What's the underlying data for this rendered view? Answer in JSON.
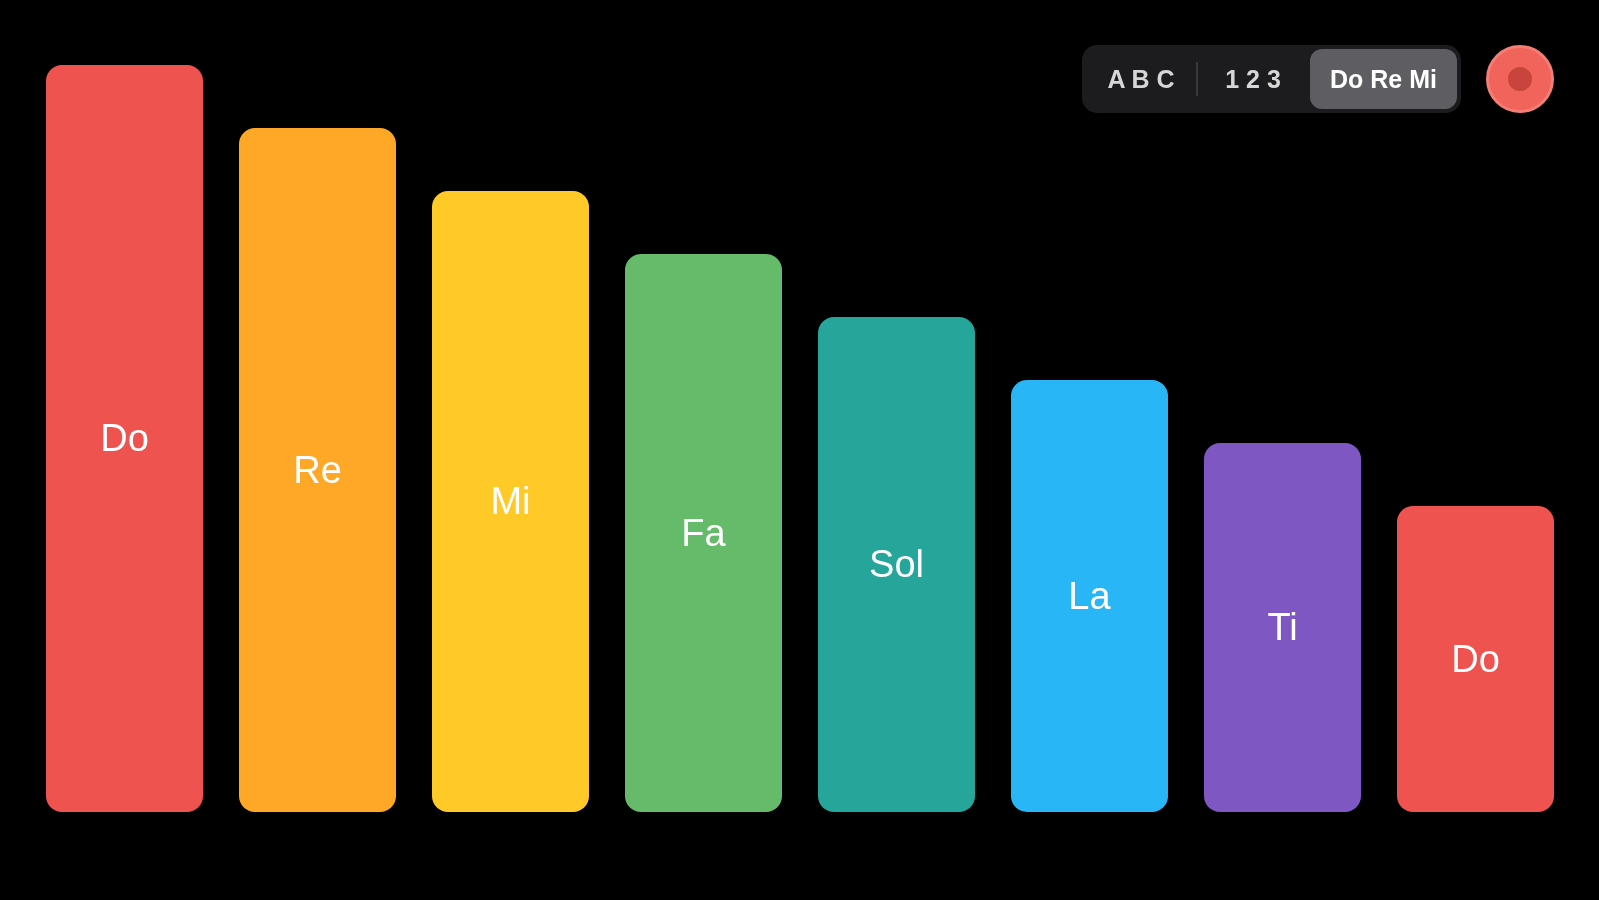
{
  "label_modes": [
    {
      "label": "A B C",
      "selected": false
    },
    {
      "label": "1 2 3",
      "selected": false
    },
    {
      "label": "Do Re Mi",
      "selected": true
    }
  ],
  "keys": [
    {
      "label": "Do",
      "color": "#ef5350"
    },
    {
      "label": "Re",
      "color": "#ffa726"
    },
    {
      "label": "Mi",
      "color": "#ffca28"
    },
    {
      "label": "Fa",
      "color": "#66bb6a"
    },
    {
      "label": "Sol",
      "color": "#26a69a"
    },
    {
      "label": "La",
      "color": "#29b6f6"
    },
    {
      "label": "Ti",
      "color": "#7e57c2"
    },
    {
      "label": "Do",
      "color": "#ef5350"
    }
  ]
}
